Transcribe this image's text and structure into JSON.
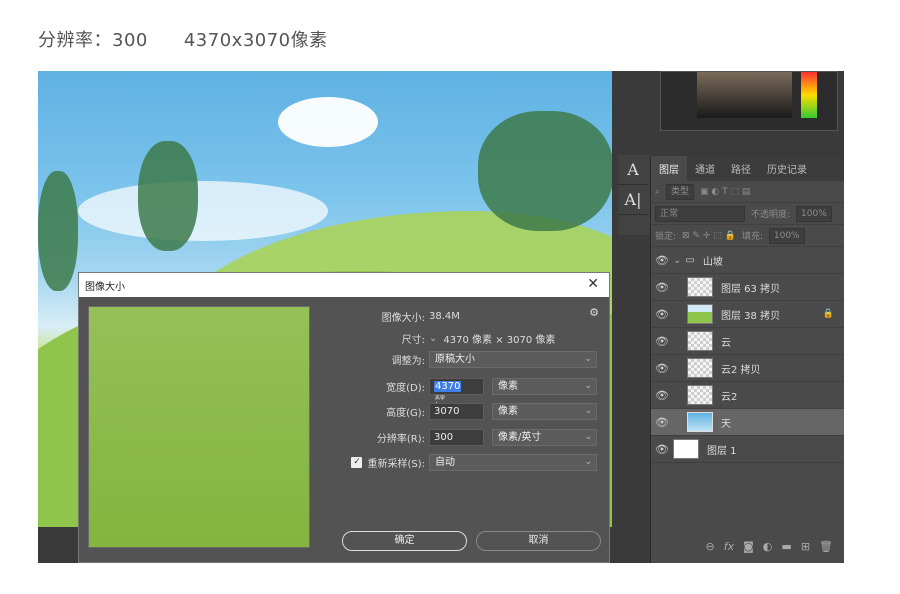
{
  "caption": {
    "resolution": "分辨率：300",
    "pixels": "4370x3070像素"
  },
  "tools": [
    "A",
    "A|"
  ],
  "layers_panel": {
    "tabs": [
      "图层",
      "通道",
      "路径",
      "历史记录"
    ],
    "filter_label": "类型",
    "blend_mode": "正常",
    "opacity_label": "不透明度:",
    "opacity_value": "100%",
    "lock_label": "锁定:",
    "fill_label": "填充:",
    "fill_value": "100%",
    "layers": [
      {
        "name": "山坡",
        "type": "group",
        "selected": false
      },
      {
        "name": "图层 63 拷贝",
        "type": "layer",
        "selected": false
      },
      {
        "name": "图层 38 拷贝",
        "type": "layer",
        "selected": false,
        "locked": true
      },
      {
        "name": "云",
        "type": "layer",
        "selected": false
      },
      {
        "name": "云2 拷贝",
        "type": "layer",
        "selected": false
      },
      {
        "name": "云2",
        "type": "layer",
        "selected": false
      },
      {
        "name": "天",
        "type": "layer",
        "selected": true
      },
      {
        "name": "图层 1",
        "type": "layer",
        "selected": false
      }
    ]
  },
  "dialog": {
    "title": "图像大小",
    "image_size_label": "图像大小:",
    "image_size_value": "38.4M",
    "dimensions_label": "尺寸:",
    "dimensions_value": "4370 像素  ×  3070 像素",
    "fit_label": "调整为:",
    "fit_value": "原稿大小",
    "width_label": "宽度(D):",
    "width_value": "4370",
    "width_unit": "像素",
    "height_label": "高度(G):",
    "height_value": "3070",
    "height_unit": "像素",
    "resolution_label": "分辨率(R):",
    "resolution_value": "300",
    "resolution_unit": "像素/英寸",
    "resample_label": "重新采样(S):",
    "resample_value": "自动",
    "resample_checked": true,
    "ok_label": "确定",
    "cancel_label": "取消"
  }
}
